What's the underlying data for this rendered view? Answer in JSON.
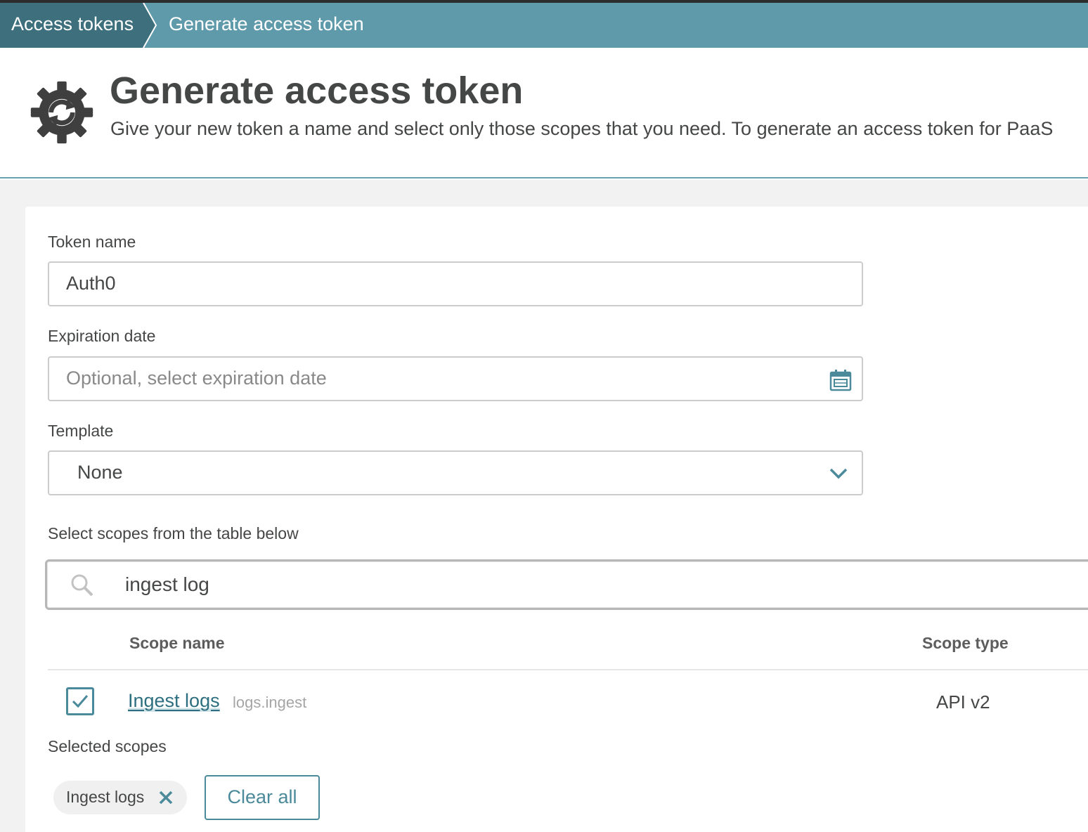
{
  "breadcrumb": {
    "items": [
      "Access tokens",
      "Generate access token"
    ]
  },
  "header": {
    "title": "Generate access token",
    "subtitle": "Give your new token a name and select only those scopes that you need. To generate an access token for PaaS",
    "icon": "gear-refresh-icon"
  },
  "form": {
    "token_name": {
      "label": "Token name",
      "value": "Auth0"
    },
    "expiration": {
      "label": "Expiration date",
      "placeholder": "Optional, select expiration date",
      "icon": "calendar-icon"
    },
    "template": {
      "label": "Template",
      "selected": "None",
      "icon": "chevron-down-icon"
    },
    "scopes_label": "Select scopes from the table below",
    "search": {
      "value": "ingest log",
      "icon": "search-icon"
    }
  },
  "table": {
    "columns": [
      "Scope name",
      "Scope type"
    ],
    "rows": [
      {
        "checked": true,
        "name": "Ingest logs",
        "id": "logs.ingest",
        "type": "API v2"
      }
    ]
  },
  "selected": {
    "label": "Selected scopes",
    "chips": [
      "Ingest logs"
    ],
    "clear_label": "Clear all"
  },
  "colors": {
    "breadcrumb_bg": "#5f9aab",
    "breadcrumb_active": "#3d6f7d",
    "accent": "#4b8a9a",
    "text": "#454646"
  }
}
